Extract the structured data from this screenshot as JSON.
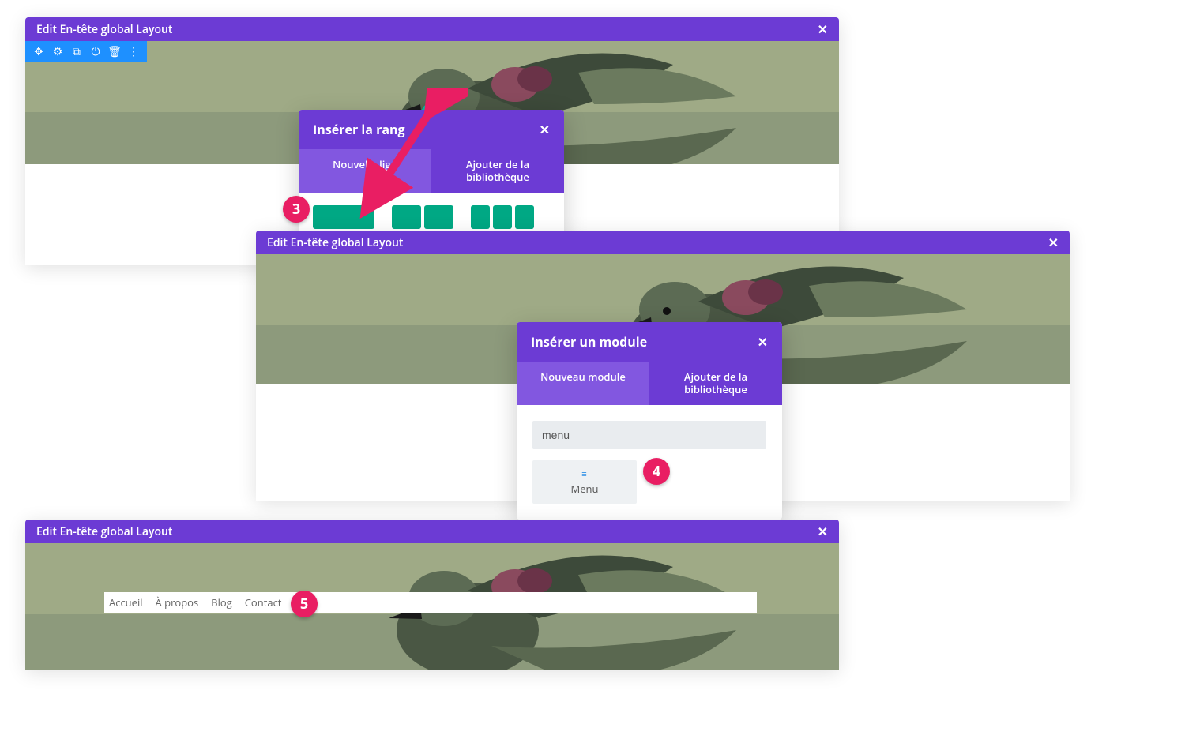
{
  "colors": {
    "purple": "#6c3bd4",
    "purple_light": "#8257e0",
    "blue_toolbar": "#1e90ff",
    "teal": "#00a884",
    "teal_bright": "#00c4a7",
    "pink": "#e91e63"
  },
  "panel1": {
    "title": "Edit En-tête global Layout",
    "toolbar_icons": [
      "move-icon",
      "gear-icon",
      "duplicate-icon",
      "power-icon",
      "trash-icon",
      "more-icon"
    ],
    "popup": {
      "title": "Insérer la rang",
      "tabs": {
        "active": "Nouvelle lign",
        "inactive": "Ajouter de la bibliothèque"
      }
    },
    "step_label": "3"
  },
  "panel2": {
    "title": "Edit En-tête global Layout",
    "popup": {
      "title": "Insérer un module",
      "tabs": {
        "active": "Nouveau module",
        "inactive": "Ajouter de la bibliothèque"
      },
      "search_value": "menu",
      "module_label": "Menu"
    },
    "step_label": "4"
  },
  "panel3": {
    "title": "Edit En-tête global Layout",
    "menu_items": [
      "Accueil",
      "À propos",
      "Blog",
      "Contact"
    ],
    "step_label": "5"
  }
}
